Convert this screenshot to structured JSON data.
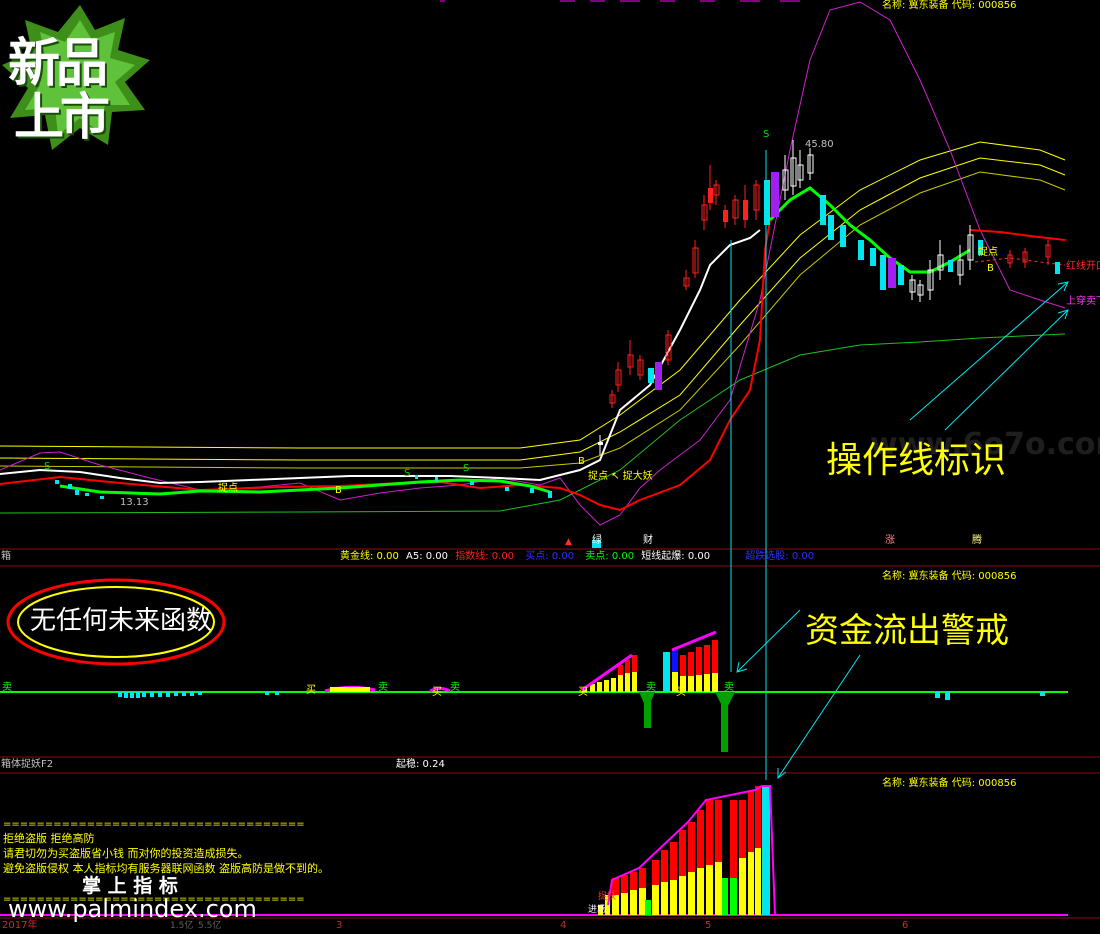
{
  "header": {
    "stock_name_label": "名称: 冀东装备  代码: 000856"
  },
  "badge": {
    "line1": "新品",
    "line2": "上市"
  },
  "main_chart": {
    "high_price_label": "45.80",
    "low_price_label": "13.13",
    "signal_s": "S",
    "signal_b": "B",
    "catch_point_label": "捉点",
    "catch_demon_label": "捉大妖",
    "catch_point_label_2": "捉点 ↖ 捉大妖",
    "red_line_open_label": "红线开口",
    "up_cross_sell_label": "上穿卖下",
    "annotation_operation_line": "操作线标识",
    "watermark": "www.6o7o.com",
    "bottom_tags": [
      "绿",
      "财",
      "涨",
      "腾"
    ],
    "buy_signal_sym": "▲"
  },
  "indicator_bar": {
    "prefix": "箱",
    "items": [
      {
        "label": "黄金线: 0.00",
        "color": "#ffff00"
      },
      {
        "label": "A5: 0.00",
        "color": "#ffffff"
      },
      {
        "label": "指数线: 0.00",
        "color": "#ff2020"
      },
      {
        "label": "买点: 0.00",
        "color": "#3030ff"
      },
      {
        "label": "卖点: 0.00",
        "color": "#00ff00"
      },
      {
        "label": "短线起爆: 0.00",
        "color": "#ffffff"
      },
      {
        "label": "超跌选股: 0.00",
        "color": "#3030ff"
      }
    ]
  },
  "panel2": {
    "stock_name_label": "名称: 冀东装备  代码: 000856",
    "no_future_function_label": "无任何未来函数",
    "capital_outflow_warning": "资金流出警戒",
    "buy_label": "买",
    "sell_label": "卖",
    "title": "箱体捉妖F2",
    "stability_label": "起稳: 0.24"
  },
  "panel3": {
    "stock_name_label": "名称: 冀东装备  代码: 000856",
    "notice_separator": "====================================",
    "notice_lines": [
      "拒绝盗版  拒绝高防",
      "请君切勿为买盗版省小钱  而对你的投资造成损失。",
      "避免盗版侵权   本人指标均有服务器联网函数  盗版高防是做不到的。"
    ],
    "brand_label": "掌 上 指 标",
    "website": "www.palmindex.com",
    "entry_label": "进场",
    "catch_label": "捉妖"
  },
  "time_axis": {
    "labels": [
      "2017年",
      "3",
      "4",
      "5",
      "6"
    ]
  },
  "status_bar": {
    "items": [
      "1.5亿",
      "5.5亿"
    ]
  },
  "colors": {
    "background": "#000000",
    "divider": "#8a1010",
    "yellow": "#ffff00",
    "green": "#00ff00",
    "red": "#ff0000",
    "cyan": "#00e5ee",
    "magenta": "#ff00ff",
    "purple": "#9900ff"
  }
}
